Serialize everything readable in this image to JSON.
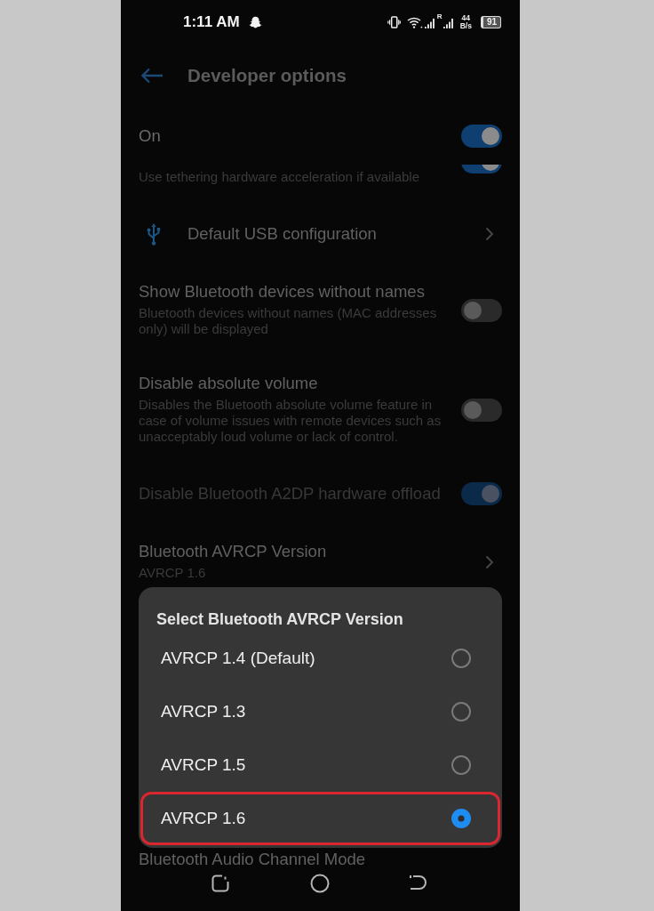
{
  "status_bar": {
    "time": "1:11 AM",
    "roaming_label": "R",
    "net_speed": "44",
    "net_speed_unit": "B/s",
    "battery": "91"
  },
  "app_bar": {
    "title": "Developer options"
  },
  "master_switch": {
    "label": "On",
    "on": true
  },
  "settings": [
    {
      "kind": "clipped_switch",
      "summary": "Use tethering hardware acceleration if available",
      "on": true,
      "disabled": false
    },
    {
      "kind": "icon_link",
      "title": "Default USB configuration",
      "disabled": false
    },
    {
      "kind": "switch",
      "title": "Show Bluetooth devices without names",
      "summary": "Bluetooth devices without names (MAC addresses only) will be displayed",
      "on": false,
      "disabled": false
    },
    {
      "kind": "switch",
      "title": "Disable absolute volume",
      "summary": "Disables the Bluetooth absolute volume feature in case of volume issues with remote devices such as unacceptably loud volume or lack of control.",
      "on": false,
      "disabled": false
    },
    {
      "kind": "switch",
      "title": "Disable Bluetooth A2DP hardware offload",
      "on": true,
      "disabled": true
    },
    {
      "kind": "link",
      "title": "Bluetooth AVRCP Version",
      "summary": "AVRCP 1.6",
      "disabled": false
    },
    {
      "kind": "partial",
      "title": "Bluetooth Audio Channel Mode",
      "disabled": false
    }
  ],
  "dialog": {
    "title": "Select Bluetooth AVRCP Version",
    "options": [
      {
        "label": "AVRCP 1.4 (Default)",
        "selected": false,
        "highlighted": false
      },
      {
        "label": "AVRCP 1.3",
        "selected": false,
        "highlighted": false
      },
      {
        "label": "AVRCP 1.5",
        "selected": false,
        "highlighted": false
      },
      {
        "label": "AVRCP 1.6",
        "selected": true,
        "highlighted": true
      }
    ]
  }
}
